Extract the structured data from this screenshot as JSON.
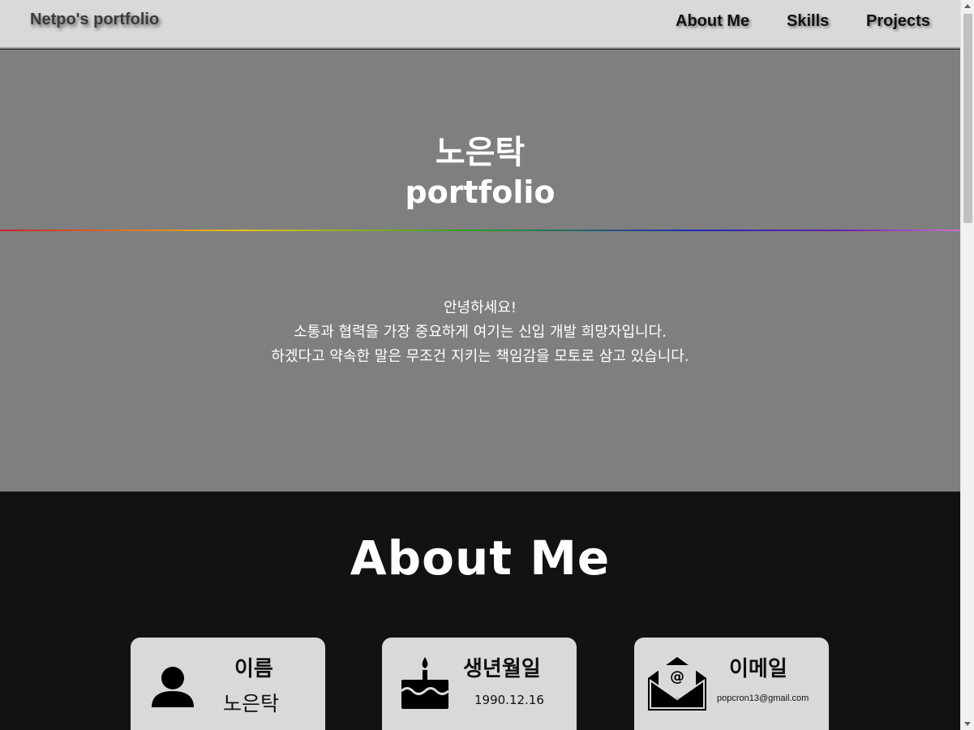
{
  "nav": {
    "brand": "Netpo's portfolio",
    "links": [
      "About Me",
      "Skills",
      "Projects"
    ]
  },
  "hero": {
    "name": "노은탁",
    "subtitle": "portfolio",
    "lines": [
      "안녕하세요!",
      "소통과 협력을 가장 중요하게 여기는 신입 개발 희망자입니다.",
      "하겠다고 약속한 말은 무조건 지키는 책임감을 모토로 삼고 있습니다."
    ]
  },
  "about": {
    "title": "About Me",
    "cards": [
      {
        "icon": "person-icon",
        "title": "이름",
        "value": "노은탁"
      },
      {
        "icon": "birthday-cake-icon",
        "title": "생년월일",
        "value": "1990.12.16"
      },
      {
        "icon": "mail-icon",
        "title": "이메일",
        "value": "popcron13@gmail.com"
      }
    ]
  },
  "colors": {
    "navbar": "#d9d9d9",
    "hero": "#7f7f7f",
    "about": "#121212",
    "card": "#d9d9d9"
  }
}
